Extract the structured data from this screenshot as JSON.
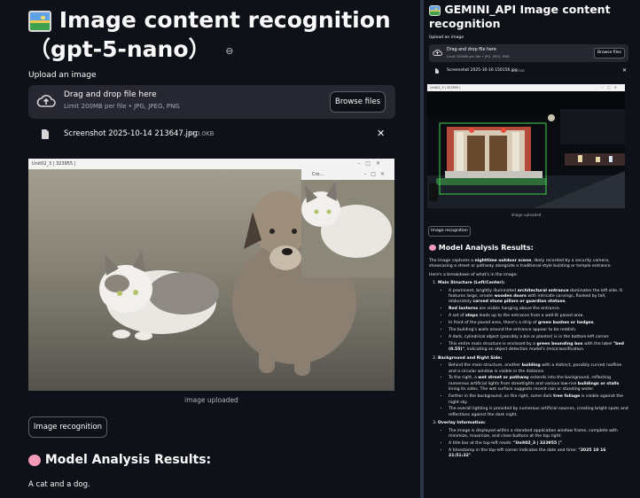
{
  "left": {
    "title": "Image content recognition（gpt-5-nano）",
    "upload_label": "Upload an image",
    "dropzone": {
      "title": "Drag and drop file here",
      "subtitle": "Limit 200MB per file • JPG, JPEG, PNG",
      "browse": "Browse files"
    },
    "file": {
      "name": "Screenshot 2025-10-14 213647.jpg",
      "size": "110.0KB"
    },
    "window": {
      "title": "Unit02_3 | 323955 |",
      "popup_title": "Cro..."
    },
    "caption": "image uploaded",
    "button": "Image recognition",
    "results_heading": "Model Analysis Results:",
    "result_text": "A cat and a dog."
  },
  "right": {
    "title": "GEMINI_API Image content recognition",
    "upload_label": "Upload an image",
    "dropzone": {
      "title": "Drag and drop file here",
      "subtitle": "Limit 200MB per file • JPG, JPEG, PNG",
      "browse": "Browse files"
    },
    "file": {
      "name": "Screenshot 2025-10-16 150156.jpg",
      "size": "91.7KB"
    },
    "window": {
      "title": "Unit02_3 | 323955 |"
    },
    "caption": "image uploaded",
    "button": "Image recognition",
    "results_heading": "Model Analysis Results:",
    "intro_pre": "The image captures a ",
    "intro_b1": "nighttime outdoor scene",
    "intro_post": ", likely recorded by a security camera, showcasing a street or pathway alongside a traditional-style building or temple entrance.",
    "breakdown": "Here's a breakdown of what's in the image:",
    "s1_title": "Main Structure (Left/Center):",
    "s1_b1_a": "A prominent, brightly illuminated ",
    "s1_b1_b": "architectural entrance",
    "s1_b1_c": " dominates the left side. It features large, ornate ",
    "s1_b1_d": "wooden doors",
    "s1_b1_e": " with intricate carvings, flanked by tall, elaborately ",
    "s1_b1_f": "carved stone pillars or guardian statues",
    "s1_b2_a": "Red lanterns",
    "s1_b2_b": " are visible hanging above the entrance.",
    "s1_b3_a": "A set of ",
    "s1_b3_b": "steps",
    "s1_b3_c": " leads up to the entrance from a well-lit paved area.",
    "s1_b4_a": "In front of the paved area, there's a strip of ",
    "s1_b4_b": "green bushes or hedges",
    "s1_b5": "The building's walls around the entrance appear to be reddish.",
    "s1_b6": "A dark, cylindrical object (possibly a bin or planter) is in the bottom-left corner.",
    "s1_b7_a": "This entire main structure is enclosed by a ",
    "s1_b7_b": "green bounding box",
    "s1_b7_c": " with the label ",
    "s1_b7_d": "\"bed (0.55)\"",
    "s1_b7_e": ", indicating an object detection model's (mis)classification.",
    "s2_title": "Background and Right Side:",
    "s2_b1_a": "Behind the main structure, another ",
    "s2_b1_b": "building",
    "s2_b1_c": " with a distinct, possibly curved roofline and a circular window is visible in the distance.",
    "s2_b2_a": "To the right, a ",
    "s2_b2_b": "wet street or pathway",
    "s2_b2_c": " extends into the background, reflecting numerous artificial lights from streetlights and various low-rise ",
    "s2_b2_d": "buildings or stalls",
    "s2_b2_e": " lining its sides. The wet surface suggests recent rain or standing water.",
    "s2_b3_a": "Farther in the background, on the right, some dark ",
    "s2_b3_b": "tree foliage",
    "s2_b3_c": " is visible against the night sky.",
    "s2_b4": "The overall lighting is provided by numerous artificial sources, creating bright spots and reflections against the dark night.",
    "s3_title": "Overlay Information:",
    "s3_b1": "The image is displayed within a standard application window frame, complete with minimize, maximize, and close buttons at the top right.",
    "s3_b2_a": "A title bar at the top-left reads: ",
    "s3_b2_b": "\"Unit02_3 | 323955 |\"",
    "s3_b3_a": "A timestamp in the top-left corner indicates the date and time: ",
    "s3_b3_b": "\"2025 10 16 21:51:32\""
  },
  "colors": {
    "bg": "#0e1117",
    "panel": "#262730",
    "box": "#3ecf4e",
    "accent": "#ff4b4b"
  }
}
